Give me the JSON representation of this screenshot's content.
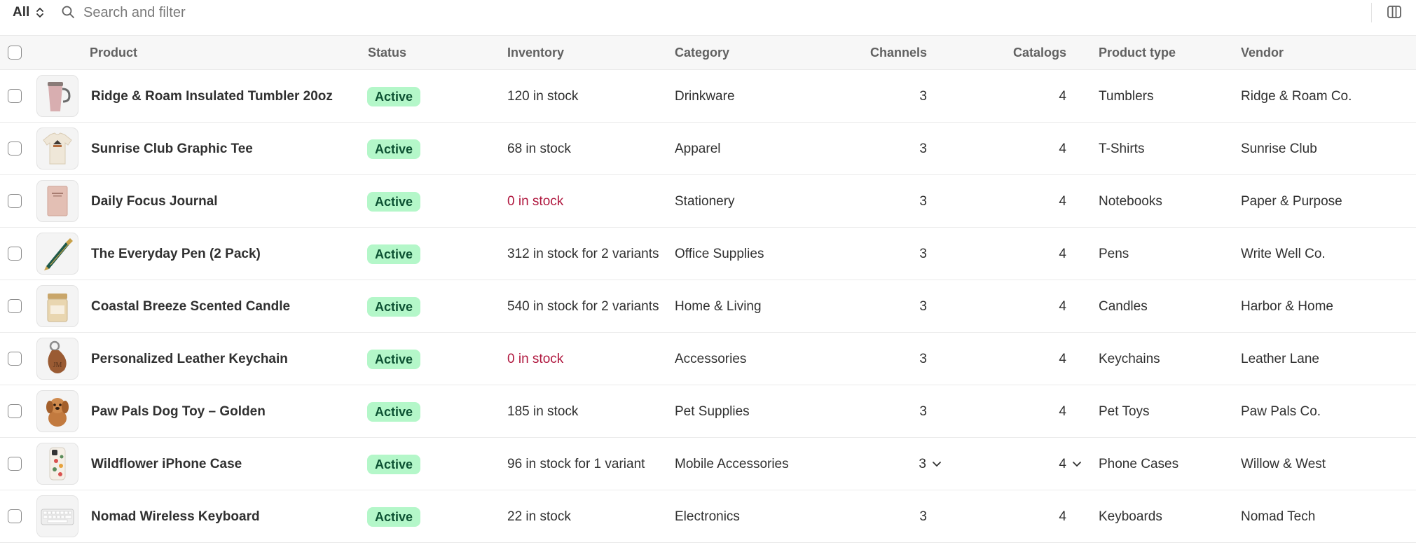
{
  "toolbar": {
    "view_label": "All",
    "search_placeholder": "Search and filter"
  },
  "columns": {
    "product": "Product",
    "status": "Status",
    "inventory": "Inventory",
    "category": "Category",
    "channels": "Channels",
    "catalogs": "Catalogs",
    "product_type": "Product type",
    "vendor": "Vendor"
  },
  "colors": {
    "active_badge_bg": "#b4f7c9",
    "active_badge_text": "#0c5132",
    "out_of_stock_text": "#b0183f",
    "header_bg": "#f7f7f7"
  },
  "rows": [
    {
      "product": "Ridge & Roam Insulated Tumbler 20oz",
      "thumb_icon": "tumbler-icon",
      "status": "Active",
      "inventory": "120 in stock",
      "out_of_stock": false,
      "category": "Drinkware",
      "channels": "3",
      "catalogs": "4",
      "product_type": "Tumblers",
      "vendor": "Ridge & Roam Co."
    },
    {
      "product": "Sunrise Club Graphic Tee",
      "thumb_icon": "tshirt-icon",
      "status": "Active",
      "inventory": "68 in stock",
      "out_of_stock": false,
      "category": "Apparel",
      "channels": "3",
      "catalogs": "4",
      "product_type": "T-Shirts",
      "vendor": "Sunrise Club"
    },
    {
      "product": "Daily Focus Journal",
      "thumb_icon": "journal-icon",
      "status": "Active",
      "inventory": "0 in stock",
      "out_of_stock": true,
      "category": "Stationery",
      "channels": "3",
      "catalogs": "4",
      "product_type": "Notebooks",
      "vendor": "Paper & Purpose"
    },
    {
      "product": "The Everyday Pen (2 Pack)",
      "thumb_icon": "pen-icon",
      "status": "Active",
      "inventory": "312 in stock for 2 variants",
      "out_of_stock": false,
      "category": "Office Supplies",
      "channels": "3",
      "catalogs": "4",
      "product_type": "Pens",
      "vendor": "Write Well Co."
    },
    {
      "product": "Coastal Breeze Scented Candle",
      "thumb_icon": "candle-icon",
      "status": "Active",
      "inventory": "540 in stock for 2 variants",
      "out_of_stock": false,
      "category": "Home & Living",
      "channels": "3",
      "catalogs": "4",
      "product_type": "Candles",
      "vendor": "Harbor & Home"
    },
    {
      "product": "Personalized Leather Keychain",
      "thumb_icon": "keychain-icon",
      "status": "Active",
      "inventory": "0 in stock",
      "out_of_stock": true,
      "category": "Accessories",
      "channels": "3",
      "catalogs": "4",
      "product_type": "Keychains",
      "vendor": "Leather Lane"
    },
    {
      "product": "Paw Pals Dog Toy – Golden",
      "thumb_icon": "dog-toy-icon",
      "status": "Active",
      "inventory": "185 in stock",
      "out_of_stock": false,
      "category": "Pet Supplies",
      "channels": "3",
      "catalogs": "4",
      "product_type": "Pet Toys",
      "vendor": "Paw Pals Co."
    },
    {
      "product": "Wildflower iPhone Case",
      "thumb_icon": "phone-case-icon",
      "status": "Active",
      "inventory": "96 in stock for 1 variant",
      "out_of_stock": false,
      "category": "Mobile Accessories",
      "channels": "3",
      "catalogs": "4",
      "product_type": "Phone Cases",
      "vendor": "Willow & West",
      "hovered": true
    },
    {
      "product": "Nomad Wireless Keyboard",
      "thumb_icon": "keyboard-icon",
      "status": "Active",
      "inventory": "22 in stock",
      "out_of_stock": false,
      "category": "Electronics",
      "channels": "3",
      "catalogs": "4",
      "product_type": "Keyboards",
      "vendor": "Nomad Tech"
    }
  ]
}
